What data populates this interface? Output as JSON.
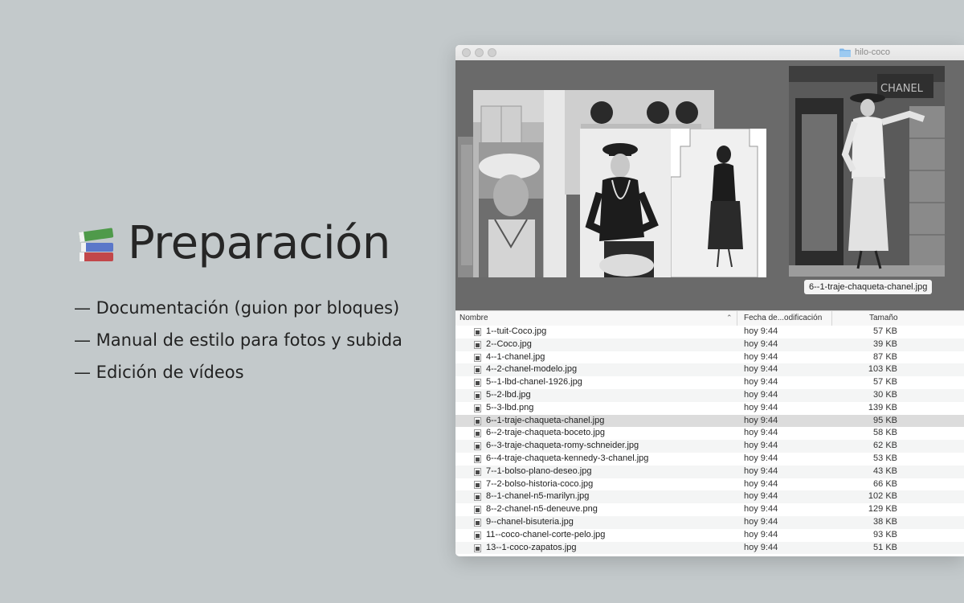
{
  "slide": {
    "title": "Preparación",
    "title_icon": "books-icon",
    "bullets": [
      "— Documentación (guion por bloques)",
      "— Manual de estilo para fotos y subida",
      "— Edición de vídeos"
    ]
  },
  "finder": {
    "window_title": "hilo-coco",
    "folder_icon": "folder-icon",
    "preview_filename": "6--1-traje-chaqueta-chanel.jpg",
    "columns": {
      "name": "Nombre",
      "date": "Fecha de...odificación",
      "size": "Tamaño"
    },
    "files": [
      {
        "name": "1--tuit-Coco.jpg",
        "date": "hoy 9:44",
        "size": "57 KB"
      },
      {
        "name": "2--Coco.jpg",
        "date": "hoy 9:44",
        "size": "39 KB"
      },
      {
        "name": "4--1-chanel.jpg",
        "date": "hoy 9:44",
        "size": "87 KB"
      },
      {
        "name": "4--2-chanel-modelo.jpg",
        "date": "hoy 9:44",
        "size": "103 KB"
      },
      {
        "name": "5--1-lbd-chanel-1926.jpg",
        "date": "hoy 9:44",
        "size": "57 KB"
      },
      {
        "name": "5--2-lbd.jpg",
        "date": "hoy 9:44",
        "size": "30 KB"
      },
      {
        "name": "5--3-lbd.png",
        "date": "hoy 9:44",
        "size": "139 KB"
      },
      {
        "name": "6--1-traje-chaqueta-chanel.jpg",
        "date": "hoy 9:44",
        "size": "95 KB",
        "selected": true
      },
      {
        "name": "6--2-traje-chaqueta-boceto.jpg",
        "date": "hoy 9:44",
        "size": "58 KB"
      },
      {
        "name": "6--3-traje-chaqueta-romy-schneider.jpg",
        "date": "hoy 9:44",
        "size": "62 KB"
      },
      {
        "name": "6--4-traje-chaqueta-kennedy-3-chanel.jpg",
        "date": "hoy 9:44",
        "size": "53 KB"
      },
      {
        "name": "7--1-bolso-plano-deseo.jpg",
        "date": "hoy 9:44",
        "size": "43 KB"
      },
      {
        "name": "7--2-bolso-historia-coco.jpg",
        "date": "hoy 9:44",
        "size": "66 KB"
      },
      {
        "name": "8--1-chanel-n5-marilyn.jpg",
        "date": "hoy 9:44",
        "size": "102 KB"
      },
      {
        "name": "8--2-chanel-n5-deneuve.png",
        "date": "hoy 9:44",
        "size": "129 KB"
      },
      {
        "name": "9--chanel-bisuteria.jpg",
        "date": "hoy 9:44",
        "size": "38 KB"
      },
      {
        "name": "11--coco-chanel-corte-pelo.jpg",
        "date": "hoy 9:44",
        "size": "93 KB"
      },
      {
        "name": "13--1-coco-zapatos.jpg",
        "date": "hoy 9:44",
        "size": "51 KB"
      }
    ]
  },
  "colors": {
    "background": "#c3c9cb",
    "preview_background": "#6a6a6a",
    "selected_row": "#dcdcdc"
  }
}
